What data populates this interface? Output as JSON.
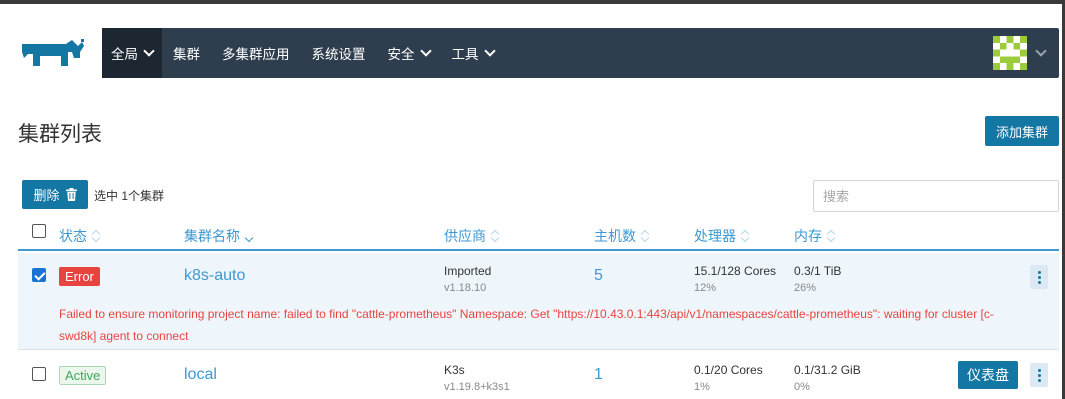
{
  "header": {
    "nav": [
      {
        "label": "全局",
        "dropdown": true,
        "active": true
      },
      {
        "label": "集群",
        "dropdown": false
      },
      {
        "label": "多集群应用",
        "dropdown": false
      },
      {
        "label": "系统设置",
        "dropdown": false
      },
      {
        "label": "安全",
        "dropdown": true
      },
      {
        "label": "工具",
        "dropdown": true
      }
    ]
  },
  "page": {
    "title": "集群列表",
    "add_cluster_label": "添加集群"
  },
  "toolbar": {
    "delete_label": "删除",
    "selected_text": "选中 1个集群",
    "search_placeholder": "搜索"
  },
  "table": {
    "columns": {
      "state": "状态",
      "name": "集群名称",
      "provider": "供应商",
      "nodes": "主机数",
      "cpu": "处理器",
      "memory": "内存"
    },
    "rows": [
      {
        "checked": true,
        "state": "Error",
        "name": "k8s-auto",
        "provider": "Imported",
        "version": "v1.18.10",
        "nodes": "5",
        "cpu": "15.1/128 Cores",
        "cpu_pct": "12%",
        "memory": "0.3/1 TiB",
        "memory_pct": "26%",
        "message": "Failed to ensure monitoring project name: failed to find \"cattle-prometheus\" Namespace: Get \"https://10.43.0.1:443/api/v1/namespaces/cattle-prometheus\": waiting for cluster [c-swd8k] agent to connect"
      },
      {
        "checked": false,
        "state": "Active",
        "name": "local",
        "provider": "K3s",
        "version": "v1.19.8+k3s1",
        "nodes": "1",
        "cpu": "0.1/20 Cores",
        "cpu_pct": "1%",
        "memory": "0.1/31.2 GiB",
        "memory_pct": "0%",
        "dashboard_label": "仪表盘"
      }
    ]
  },
  "colors": {
    "header_bg": "#2f3e4e",
    "primary": "#1476a3",
    "link": "#3d98d3",
    "error": "#e8443f",
    "success": "#44a55a"
  }
}
